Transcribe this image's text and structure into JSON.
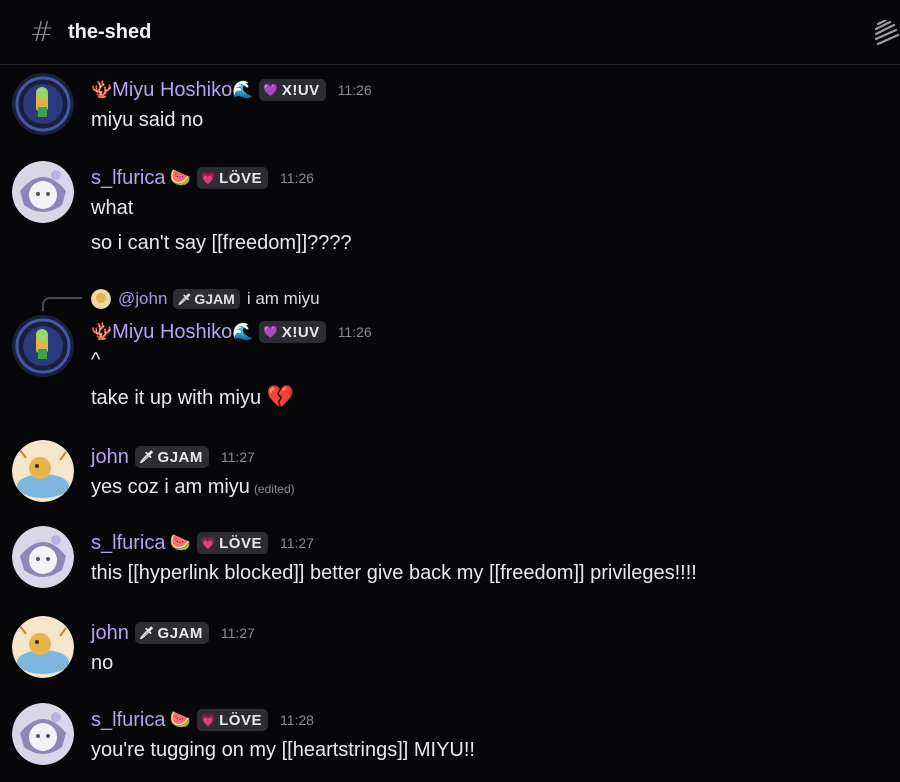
{
  "header": {
    "channel_name": "the-shed",
    "hash_icon": "hash-icon",
    "threads_icon": "threads-icon"
  },
  "users": {
    "miyu": {
      "name": "Miyu Hoshiko",
      "prefix_emoji": "🪸",
      "suffix_emoji": "🌊",
      "badge": "X!UV",
      "badge_icon": "💜",
      "color": "#b6a2f5"
    },
    "lfurica": {
      "name": "s_lfurica",
      "suffix_emoji": "🍉",
      "badge": "LÖVE",
      "badge_icon": "💗",
      "color": "#b6a2f5"
    },
    "john": {
      "name": "john",
      "badge": "GJAM",
      "badge_icon": "🗡",
      "color": "#b6a2f5"
    }
  },
  "messages": [
    {
      "user": "Miyu Hoshiko",
      "time": "11:26",
      "lines": [
        "miyu said no"
      ]
    },
    {
      "user": "s_lfurica",
      "time": "11:26",
      "lines": [
        "what",
        "so i can't say [[freedom]]????"
      ]
    },
    {
      "reply_to": {
        "name": "@john",
        "badge": "GJAM",
        "text": "i am miyu"
      },
      "user": "Miyu Hoshiko",
      "time": "11:26",
      "lines": [
        "^",
        "take it up with miyu"
      ],
      "trail_emoji": "💔"
    },
    {
      "user": "john",
      "time": "11:27",
      "lines": [
        "yes coz i am miyu"
      ],
      "edited": "(edited)"
    },
    {
      "user": "s_lfurica",
      "time": "11:27",
      "lines": [
        "this [[hyperlink blocked]] better give back my [[freedom]] privileges!!!!"
      ]
    },
    {
      "user": "john",
      "time": "11:27",
      "lines": [
        "no"
      ]
    },
    {
      "user": "s_lfurica",
      "time": "11:28",
      "lines": [
        "you're tugging on my [[heartstrings]] MIYU!!"
      ]
    }
  ]
}
